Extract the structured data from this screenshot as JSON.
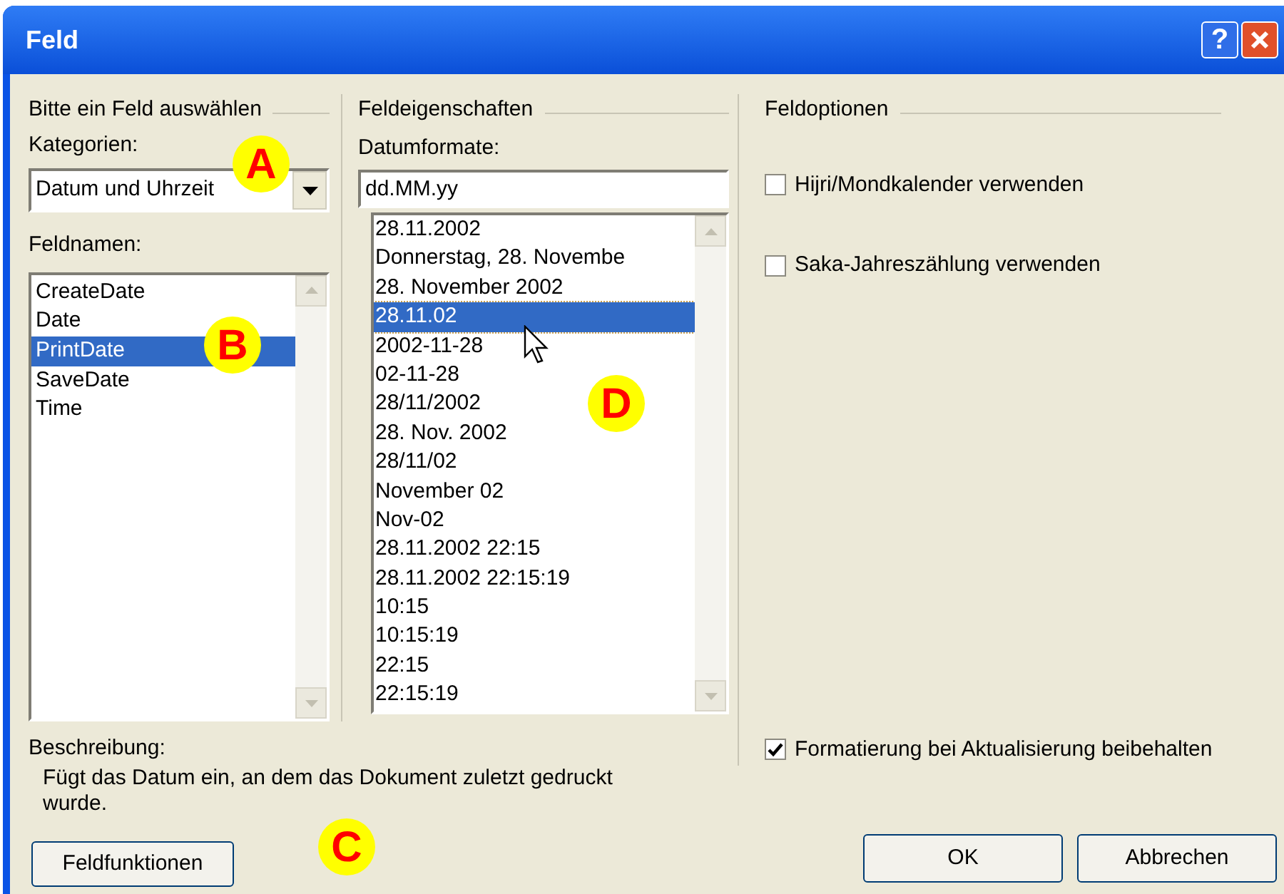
{
  "window": {
    "title": "Feld",
    "help_button": "?"
  },
  "field_selection": {
    "heading": "Bitte ein Feld auswählen",
    "categories_label": "Kategorien:",
    "category_value": "Datum und Uhrzeit",
    "field_names_label": "Feldnamen:",
    "field_names": [
      {
        "label": "CreateDate",
        "selected": false
      },
      {
        "label": "Date",
        "selected": false
      },
      {
        "label": "PrintDate",
        "selected": true
      },
      {
        "label": "SaveDate",
        "selected": false
      },
      {
        "label": "Time",
        "selected": false
      }
    ]
  },
  "field_properties": {
    "heading": "Feldeigenschaften",
    "date_formats_label": "Datumformate:",
    "date_format_value": "dd.MM.yy",
    "date_formats": [
      {
        "label": "28.11.2002",
        "selected": false
      },
      {
        "label": "Donnerstag, 28. Novembe",
        "selected": false
      },
      {
        "label": "28. November 2002",
        "selected": false
      },
      {
        "label": "28.11.02",
        "selected": true
      },
      {
        "label": "2002-11-28",
        "selected": false
      },
      {
        "label": "02-11-28",
        "selected": false
      },
      {
        "label": "28/11/2002",
        "selected": false
      },
      {
        "label": "28. Nov. 2002",
        "selected": false
      },
      {
        "label": "28/11/02",
        "selected": false
      },
      {
        "label": "November 02",
        "selected": false
      },
      {
        "label": "Nov-02",
        "selected": false
      },
      {
        "label": "28.11.2002 22:15",
        "selected": false
      },
      {
        "label": "28.11.2002 22:15:19",
        "selected": false
      },
      {
        "label": "10:15",
        "selected": false
      },
      {
        "label": "10:15:19",
        "selected": false
      },
      {
        "label": "22:15",
        "selected": false
      },
      {
        "label": "22:15:19",
        "selected": false
      }
    ]
  },
  "field_options": {
    "heading": "Feldoptionen",
    "options": [
      {
        "label": "Hijri/Mondkalender verwenden",
        "checked": false
      },
      {
        "label": "Saka-Jahreszählung verwenden",
        "checked": false
      }
    ]
  },
  "description": {
    "label": "Beschreibung:",
    "text": "Fügt das Datum ein, an dem das Dokument zuletzt gedruckt wurde."
  },
  "preserve_formatting": {
    "label": "Formatierung bei Aktualisierung beibehalten",
    "checked": true
  },
  "buttons": {
    "field_codes": "Feldfunktionen",
    "ok": "OK",
    "cancel": "Abbrechen"
  },
  "annotations": [
    "A",
    "B",
    "C",
    "D"
  ]
}
